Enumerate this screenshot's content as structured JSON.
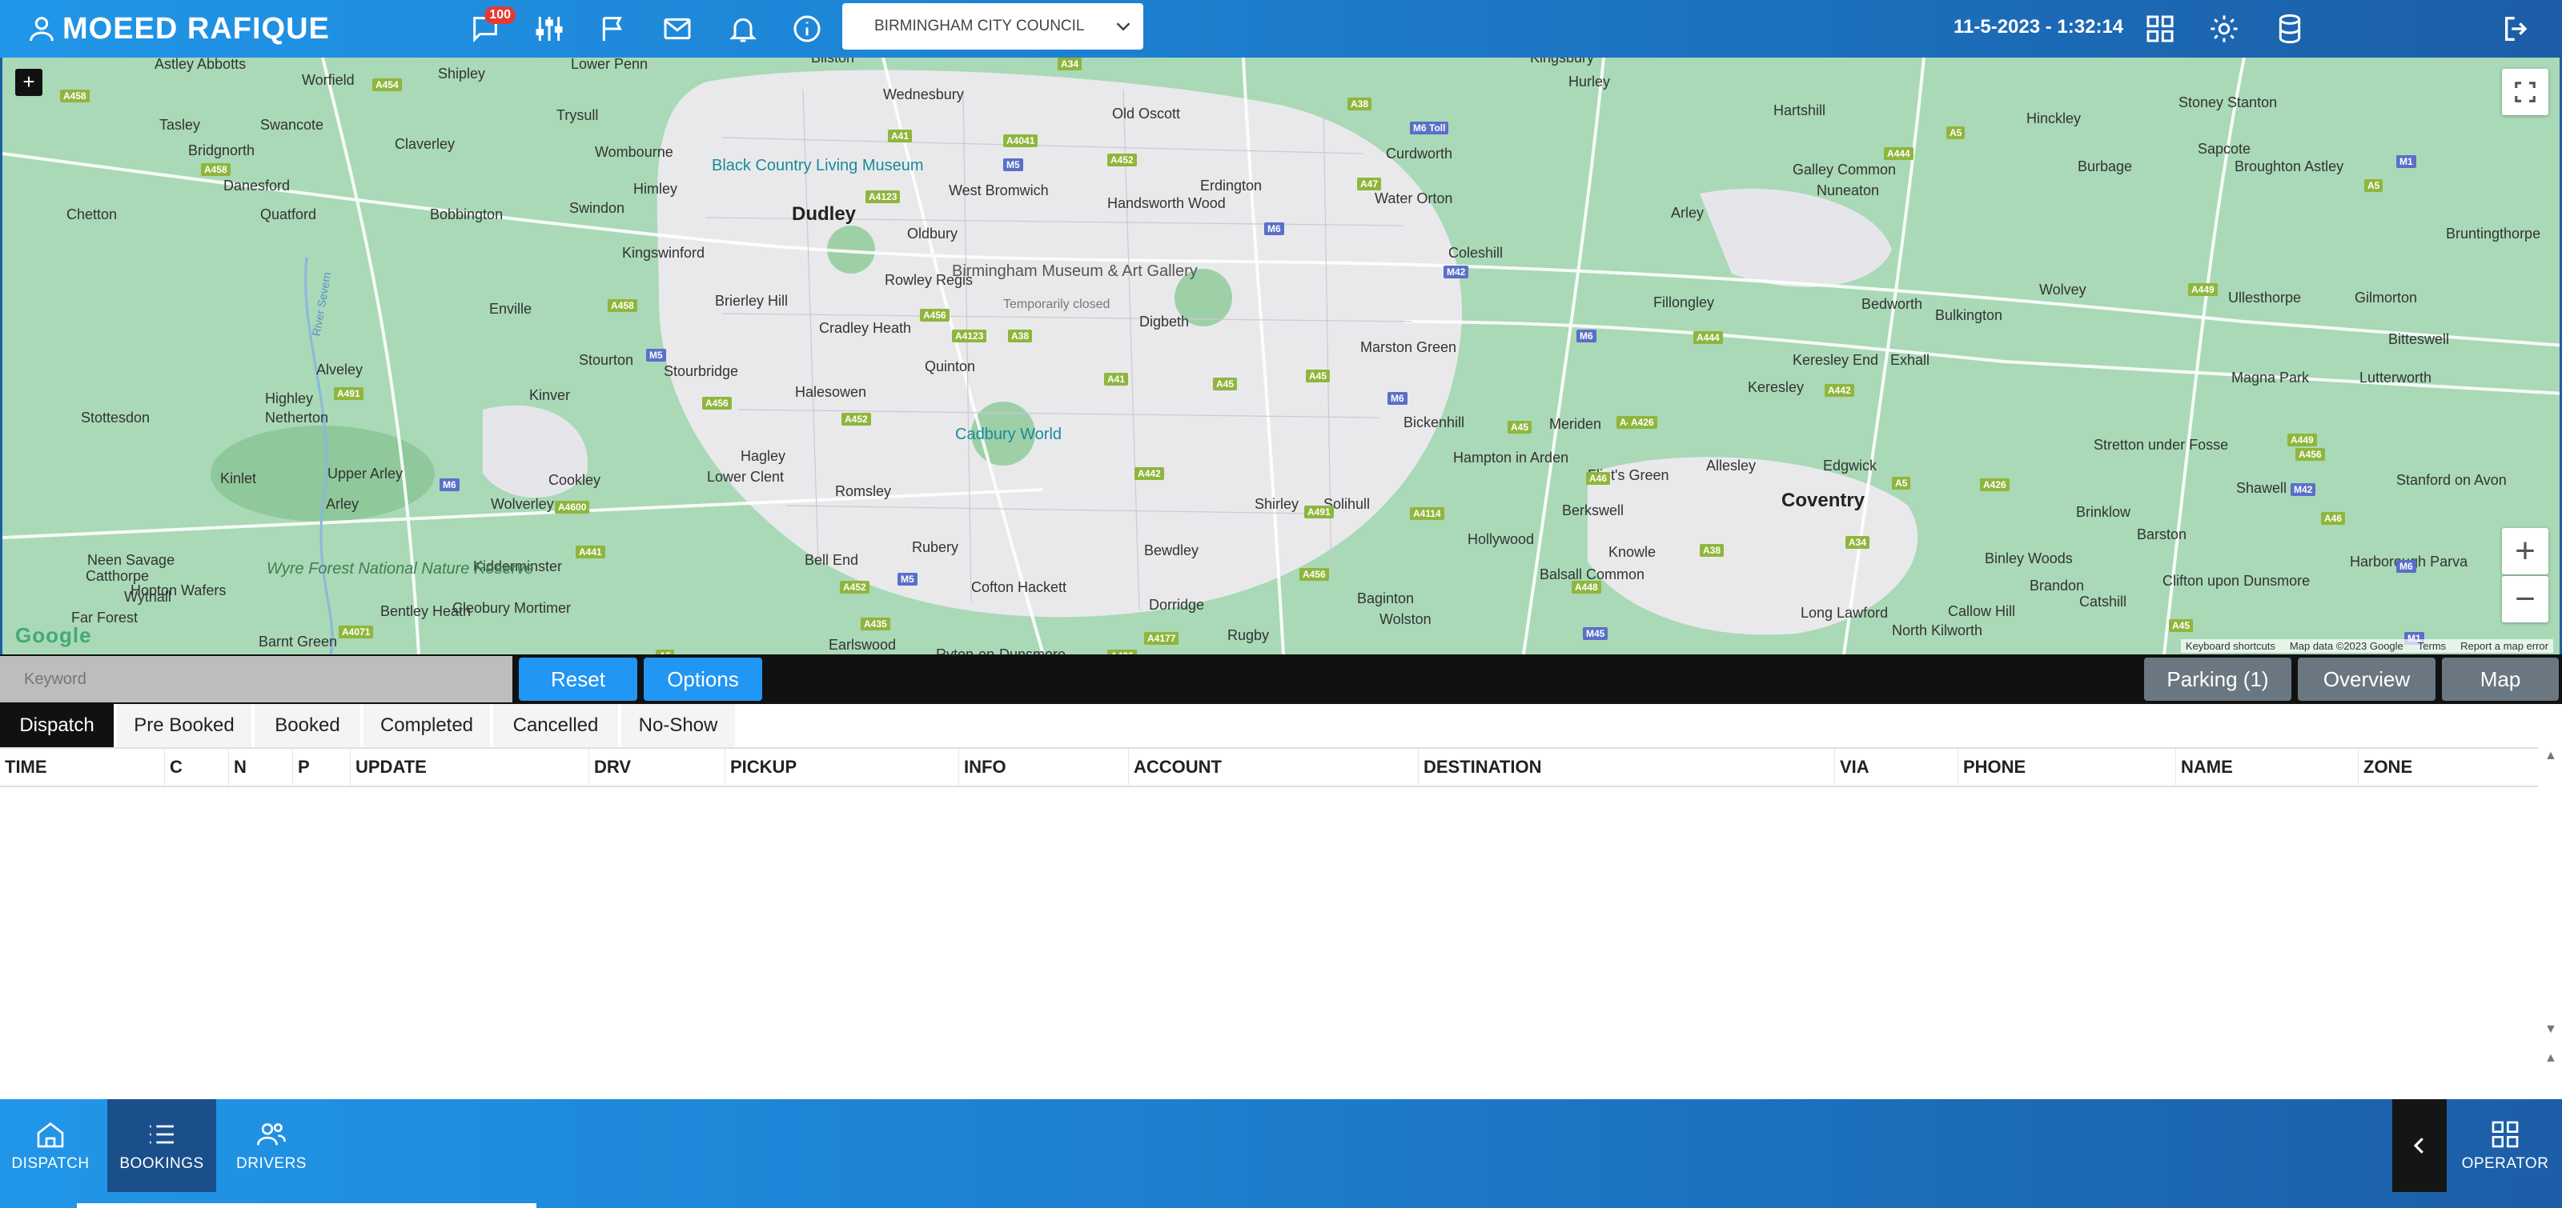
{
  "header": {
    "user_name": "MOEED RAFIQUE",
    "message_badge": "100",
    "council": "BIRMINGHAM CITY COUNCIL",
    "datetime": "11-5-2023 - 1:32:14"
  },
  "map": {
    "places": [
      {
        "name": "Astley Abbotts",
        "big": false
      },
      {
        "name": "Worfield",
        "big": false
      },
      {
        "name": "Shipley",
        "big": false
      },
      {
        "name": "Lower Penn",
        "big": false
      },
      {
        "name": "Bilston",
        "big": false
      },
      {
        "name": "Wednesbury",
        "big": false
      },
      {
        "name": "Old Oscott",
        "big": false
      },
      {
        "name": "Kingsbury",
        "big": false
      },
      {
        "name": "Hurley",
        "big": false
      },
      {
        "name": "Hartshill",
        "big": false
      },
      {
        "name": "Hinckley",
        "big": false
      },
      {
        "name": "Stoney Stanton",
        "big": false
      },
      {
        "name": "Tasley",
        "big": false
      },
      {
        "name": "Swancote",
        "big": false
      },
      {
        "name": "Trysull",
        "big": false
      },
      {
        "name": "Bridgnorth",
        "big": false
      },
      {
        "name": "Claverley",
        "big": false
      },
      {
        "name": "Wombourne",
        "big": false
      },
      {
        "name": "Curdworth",
        "big": false
      },
      {
        "name": "Galley Common",
        "big": false
      },
      {
        "name": "Sapcote",
        "big": false
      },
      {
        "name": "Burbage",
        "big": false
      },
      {
        "name": "Broughton Astley",
        "big": false
      },
      {
        "name": "Danesford",
        "big": false
      },
      {
        "name": "Himley",
        "big": false
      },
      {
        "name": "West Bromwich",
        "big": false
      },
      {
        "name": "Handsworth Wood",
        "big": false
      },
      {
        "name": "Erdington",
        "big": false
      },
      {
        "name": "Water Orton",
        "big": false
      },
      {
        "name": "Nuneaton",
        "big": false
      },
      {
        "name": "Chetton",
        "big": false
      },
      {
        "name": "Quatford",
        "big": false
      },
      {
        "name": "Bobbington",
        "big": false
      },
      {
        "name": "Swindon",
        "big": false
      },
      {
        "name": "Dudley",
        "big": true
      },
      {
        "name": "Oldbury",
        "big": false
      },
      {
        "name": "Arley",
        "big": false
      },
      {
        "name": "Bruntingthorpe",
        "big": false
      },
      {
        "name": "Kingswinford",
        "big": false
      },
      {
        "name": "Rowley Regis",
        "big": false
      },
      {
        "name": "Digbeth",
        "big": false
      },
      {
        "name": "Coleshill",
        "big": false
      },
      {
        "name": "Enville",
        "big": false
      },
      {
        "name": "Brierley Hill",
        "big": false
      },
      {
        "name": "Fillongley",
        "big": false
      },
      {
        "name": "Bedworth",
        "big": false
      },
      {
        "name": "Wolvey",
        "big": false
      },
      {
        "name": "Ullesthorpe",
        "big": false
      },
      {
        "name": "Gilmorton",
        "big": false
      },
      {
        "name": "Bulkington",
        "big": false
      },
      {
        "name": "Cradley Heath",
        "big": false
      },
      {
        "name": "Marston Green",
        "big": false
      },
      {
        "name": "Bitteswell",
        "big": false
      },
      {
        "name": "Alveley",
        "big": false
      },
      {
        "name": "Stourton",
        "big": false
      },
      {
        "name": "Stourbridge",
        "big": false
      },
      {
        "name": "Quinton",
        "big": false
      },
      {
        "name": "Keresley End",
        "big": false
      },
      {
        "name": "Exhall",
        "big": false
      },
      {
        "name": "Highley",
        "big": false
      },
      {
        "name": "Netherton",
        "big": false
      },
      {
        "name": "Kinver",
        "big": false
      },
      {
        "name": "Halesowen",
        "big": false
      },
      {
        "name": "Keresley",
        "big": false
      },
      {
        "name": "Magna Park",
        "big": false
      },
      {
        "name": "Lutterworth",
        "big": false
      },
      {
        "name": "Stottesdon",
        "big": false
      },
      {
        "name": "Bickenhill",
        "big": false
      },
      {
        "name": "Meriden",
        "big": false
      },
      {
        "name": "Edgwick",
        "big": false
      },
      {
        "name": "Hagley",
        "big": false
      },
      {
        "name": "Lower Clent",
        "big": false
      },
      {
        "name": "Hampton in Arden",
        "big": false
      },
      {
        "name": "Stretton under Fosse",
        "big": false
      },
      {
        "name": "Kinlet",
        "big": false
      },
      {
        "name": "Upper Arley",
        "big": false
      },
      {
        "name": "Cookley",
        "big": false
      },
      {
        "name": "Romsley",
        "big": false
      },
      {
        "name": "Flint's Green",
        "big": false
      },
      {
        "name": "Allesley",
        "big": false
      },
      {
        "name": "Arley",
        "big": false
      },
      {
        "name": "Wolverley",
        "big": false
      },
      {
        "name": "Shirley",
        "big": false
      },
      {
        "name": "Solihull",
        "big": false
      },
      {
        "name": "Berkswell",
        "big": false
      },
      {
        "name": "Coventry",
        "big": true
      },
      {
        "name": "Brinklow",
        "big": false
      },
      {
        "name": "Shawell",
        "big": false
      },
      {
        "name": "Stanford on Avon",
        "big": false
      },
      {
        "name": "Neen Savage",
        "big": false
      },
      {
        "name": "Kidderminster",
        "big": false
      },
      {
        "name": "Rubery",
        "big": false
      },
      {
        "name": "Hollywood",
        "big": false
      },
      {
        "name": "Barston",
        "big": false
      },
      {
        "name": "Harborough Parva",
        "big": false
      },
      {
        "name": "Catthorpe",
        "big": false
      },
      {
        "name": "Hopton Wafers",
        "big": false
      },
      {
        "name": "Cleobury Mortimer",
        "big": false
      },
      {
        "name": "Bewdley",
        "big": false
      },
      {
        "name": "Bell End",
        "big": false
      },
      {
        "name": "Cofton Hackett",
        "big": false
      },
      {
        "name": "Knowle",
        "big": false
      },
      {
        "name": "Balsall Common",
        "big": false
      },
      {
        "name": "Binley Woods",
        "big": false
      },
      {
        "name": "Brandon",
        "big": false
      },
      {
        "name": "Clifton upon Dunsmore",
        "big": false
      },
      {
        "name": "Far Forest",
        "big": false
      },
      {
        "name": "Wythall",
        "big": false
      },
      {
        "name": "Bentley Heath",
        "big": false
      },
      {
        "name": "Dorridge",
        "big": false
      },
      {
        "name": "Baginton",
        "big": false
      },
      {
        "name": "Wolston",
        "big": false
      },
      {
        "name": "Long Lawford",
        "big": false
      },
      {
        "name": "Callow Hill",
        "big": false
      },
      {
        "name": "Catshill",
        "big": false
      },
      {
        "name": "Barnt Green",
        "big": false
      },
      {
        "name": "Earlswood",
        "big": false
      },
      {
        "name": "Ryton-on-Dunsmore",
        "big": false
      },
      {
        "name": "Rugby",
        "big": false
      },
      {
        "name": "North Kilworth",
        "big": false
      }
    ],
    "pois": [
      "Black Country Living Museum",
      "Birmingham Museum & Art Gallery",
      "Temporarily closed",
      "Cadbury World",
      "Wyre Forest National Nature Reserve",
      "River Severn"
    ],
    "roads": [
      "A458",
      "A454",
      "A4123",
      "A4041",
      "A41",
      "A34",
      "A452",
      "A38",
      "M6 Toll",
      "A5",
      "A444",
      "M1",
      "A458",
      "M5",
      "M6",
      "A47",
      "M42",
      "A5",
      "A449",
      "A458",
      "M5",
      "A456",
      "A4123",
      "A38",
      "A41",
      "A45",
      "A45",
      "M6",
      "M6",
      "A444",
      "A442",
      "A491",
      "A456",
      "A452",
      "A45",
      "A435",
      "A426",
      "A442",
      "A449",
      "M6",
      "A4600",
      "A46",
      "A5",
      "A426",
      "A456",
      "M42",
      "A46",
      "A441",
      "A4114",
      "A491",
      "A38",
      "A34",
      "A452",
      "M5",
      "A456",
      "A448",
      "A435",
      "A4071",
      "A5",
      "A4177",
      "A45",
      "M6",
      "M45",
      "M1",
      "A426"
    ],
    "keyboard_shortcuts": "Keyboard shortcuts",
    "map_data": "Map data ©2023 Google",
    "terms": "Terms",
    "report": "Report a map error",
    "google": "Google",
    "plus_small": "+",
    "zoom_in": "+",
    "zoom_out": "−"
  },
  "toolbar": {
    "keyword_placeholder": "Keyword",
    "reset": "Reset",
    "options": "Options",
    "parking": "Parking (1)",
    "overview": "Overview",
    "map": "Map"
  },
  "tabs": [
    "Dispatch",
    "Pre Booked",
    "Booked",
    "Completed",
    "Cancelled",
    "No-Show"
  ],
  "table": {
    "columns": [
      "TIME",
      "C",
      "N",
      "P",
      "UPDATE",
      "DRV",
      "PICKUP",
      "INFO",
      "ACCOUNT",
      "DESTINATION",
      "VIA",
      "PHONE",
      "NAME",
      "ZONE"
    ],
    "rows": []
  },
  "bottom_nav": {
    "dispatch": "DISPATCH",
    "bookings": "BOOKINGS",
    "drivers": "DRIVERS",
    "operator": "OPERATOR"
  },
  "colors": {
    "accent": "#2196f3",
    "header_start": "#2196e8",
    "header_end": "#1c5ea7",
    "active_tab": "#111111",
    "badge": "#e53935"
  }
}
